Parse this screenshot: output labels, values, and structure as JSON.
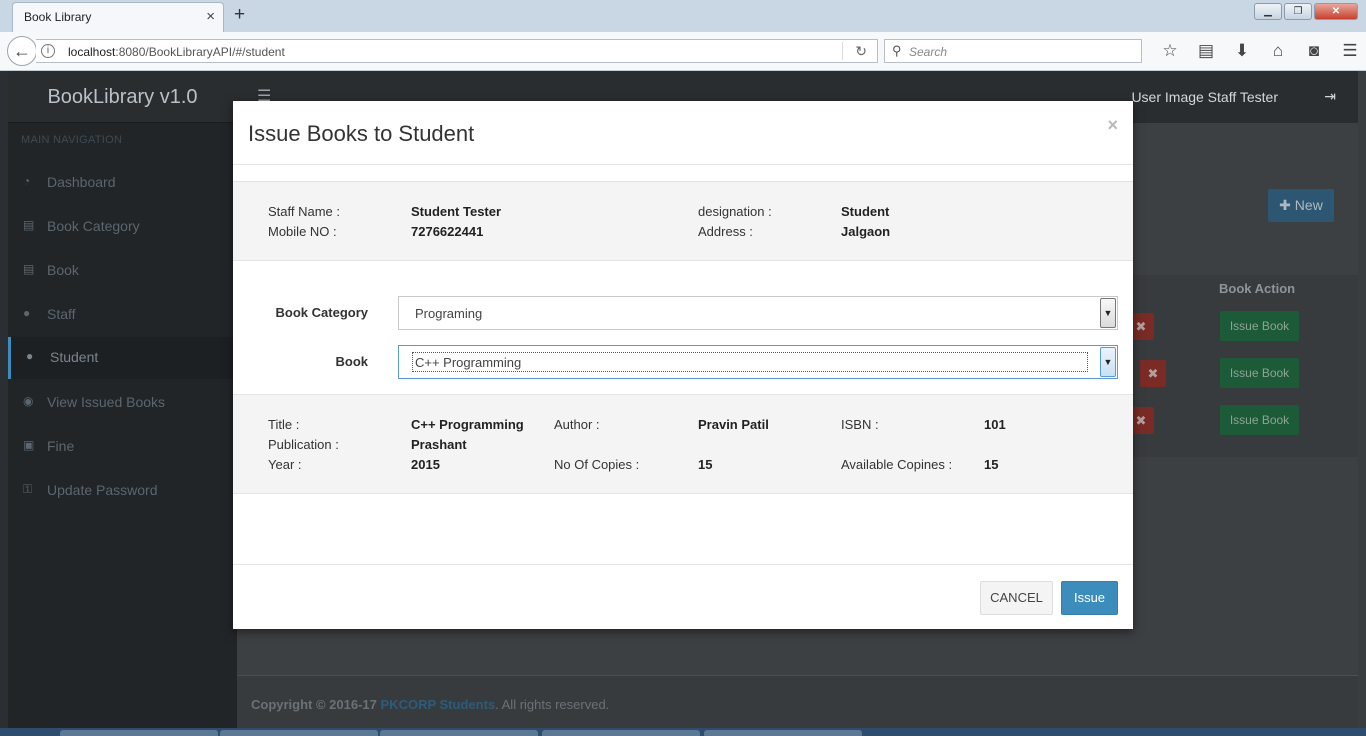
{
  "browser": {
    "tab_title": "Book Library",
    "tab_close": "×",
    "new_tab": "+",
    "url_host": "localhost",
    "url_path": ":8080/BookLibraryAPI/#/student",
    "search_placeholder": "Search",
    "window_buttons": {
      "minimize": "▁",
      "restore": "❐",
      "close": "✕"
    },
    "toolbar_icons": [
      "star-icon",
      "reader-icon",
      "download-icon",
      "home-icon",
      "pocket-icon",
      "menu-icon"
    ]
  },
  "app": {
    "logo": "BookLibrary v1.0",
    "user": "User Image Staff Tester",
    "sidebar_heading": "MAIN NAVIGATION",
    "sidebar_items": [
      {
        "label": "Dashboard",
        "icon": "dashboard-icon"
      },
      {
        "label": "Book Category",
        "icon": "book-icon"
      },
      {
        "label": "Book",
        "icon": "book-icon"
      },
      {
        "label": "Staff",
        "icon": "user-icon"
      },
      {
        "label": "Student",
        "icon": "user-icon",
        "active": true
      },
      {
        "label": "View Issued Books",
        "icon": "eye-icon"
      },
      {
        "label": "Fine",
        "icon": "money-icon"
      },
      {
        "label": "Update Password",
        "icon": "key-icon"
      }
    ],
    "new_button": "New",
    "table_header_action": "Book Action",
    "issue_book_label": "Issue Book",
    "delete_label": "✖",
    "footer": {
      "prefix": "Copyright © 2016-17 ",
      "link": "PKCORP Students",
      "suffix": ". All rights reserved."
    }
  },
  "modal": {
    "title": "Issue Books to Student",
    "close": "×",
    "staff": {
      "name_label": "Staff Name :",
      "name": "Student Tester",
      "mobile_label": "Mobile NO :",
      "mobile": "7276622441",
      "designation_label": "designation :",
      "designation": "Student",
      "address_label": "Address :",
      "address": "Jalgaon"
    },
    "form": {
      "category_label": "Book Category",
      "category_value": "Programing",
      "book_label": "Book",
      "book_value": "C++ Programming"
    },
    "book": {
      "title_label": "Title :",
      "title": "C++ Programming",
      "publication_label": "Publication :",
      "publication": "Prashant",
      "year_label": "Year :",
      "year": "2015",
      "author_label": "Author :",
      "author": "Pravin Patil",
      "copies_label": "No Of Copies :",
      "copies": "15",
      "isbn_label": "ISBN :",
      "isbn": "101",
      "available_label": "Available Copines :",
      "available": "15"
    },
    "cancel_label": "CANCEL",
    "issue_label": "Issue"
  }
}
